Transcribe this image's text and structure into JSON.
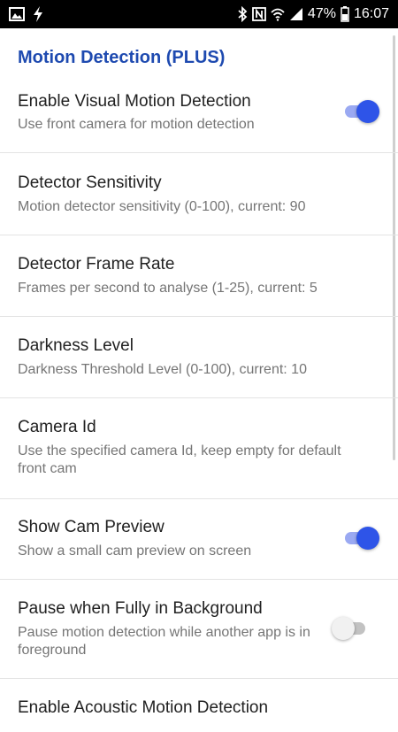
{
  "status_bar": {
    "battery_percent": "47%",
    "time": "16:07",
    "left_icons": [
      "image-icon",
      "flash-icon"
    ],
    "right_icons": [
      "bluetooth-icon",
      "nfc-icon",
      "wifi-icon",
      "signal-icon",
      "battery-icon"
    ]
  },
  "section": {
    "title": "Motion Detection (PLUS)"
  },
  "preferences": [
    {
      "title": "Enable Visual Motion Detection",
      "summary": "Use front camera for motion detection",
      "switch": "on"
    },
    {
      "title": "Detector Sensitivity",
      "summary": "Motion detector sensitivity (0-100), current: 90"
    },
    {
      "title": "Detector Frame Rate",
      "summary": "Frames per second to analyse (1-25), current: 5"
    },
    {
      "title": "Darkness Level",
      "summary": "Darkness Threshold Level (0-100), current: 10"
    },
    {
      "title": "Camera Id",
      "summary": "Use the specified camera Id, keep empty for default front cam"
    },
    {
      "title": "Show Cam Preview",
      "summary": "Show a small cam preview on screen",
      "switch": "on"
    },
    {
      "title": "Pause when Fully in Background",
      "summary": "Pause motion detection while another app is in foreground",
      "switch": "off"
    },
    {
      "title": "Enable Acoustic Motion Detection"
    }
  ],
  "colors": {
    "accent": "#2e54e8",
    "section_title": "#1e4ab0"
  }
}
